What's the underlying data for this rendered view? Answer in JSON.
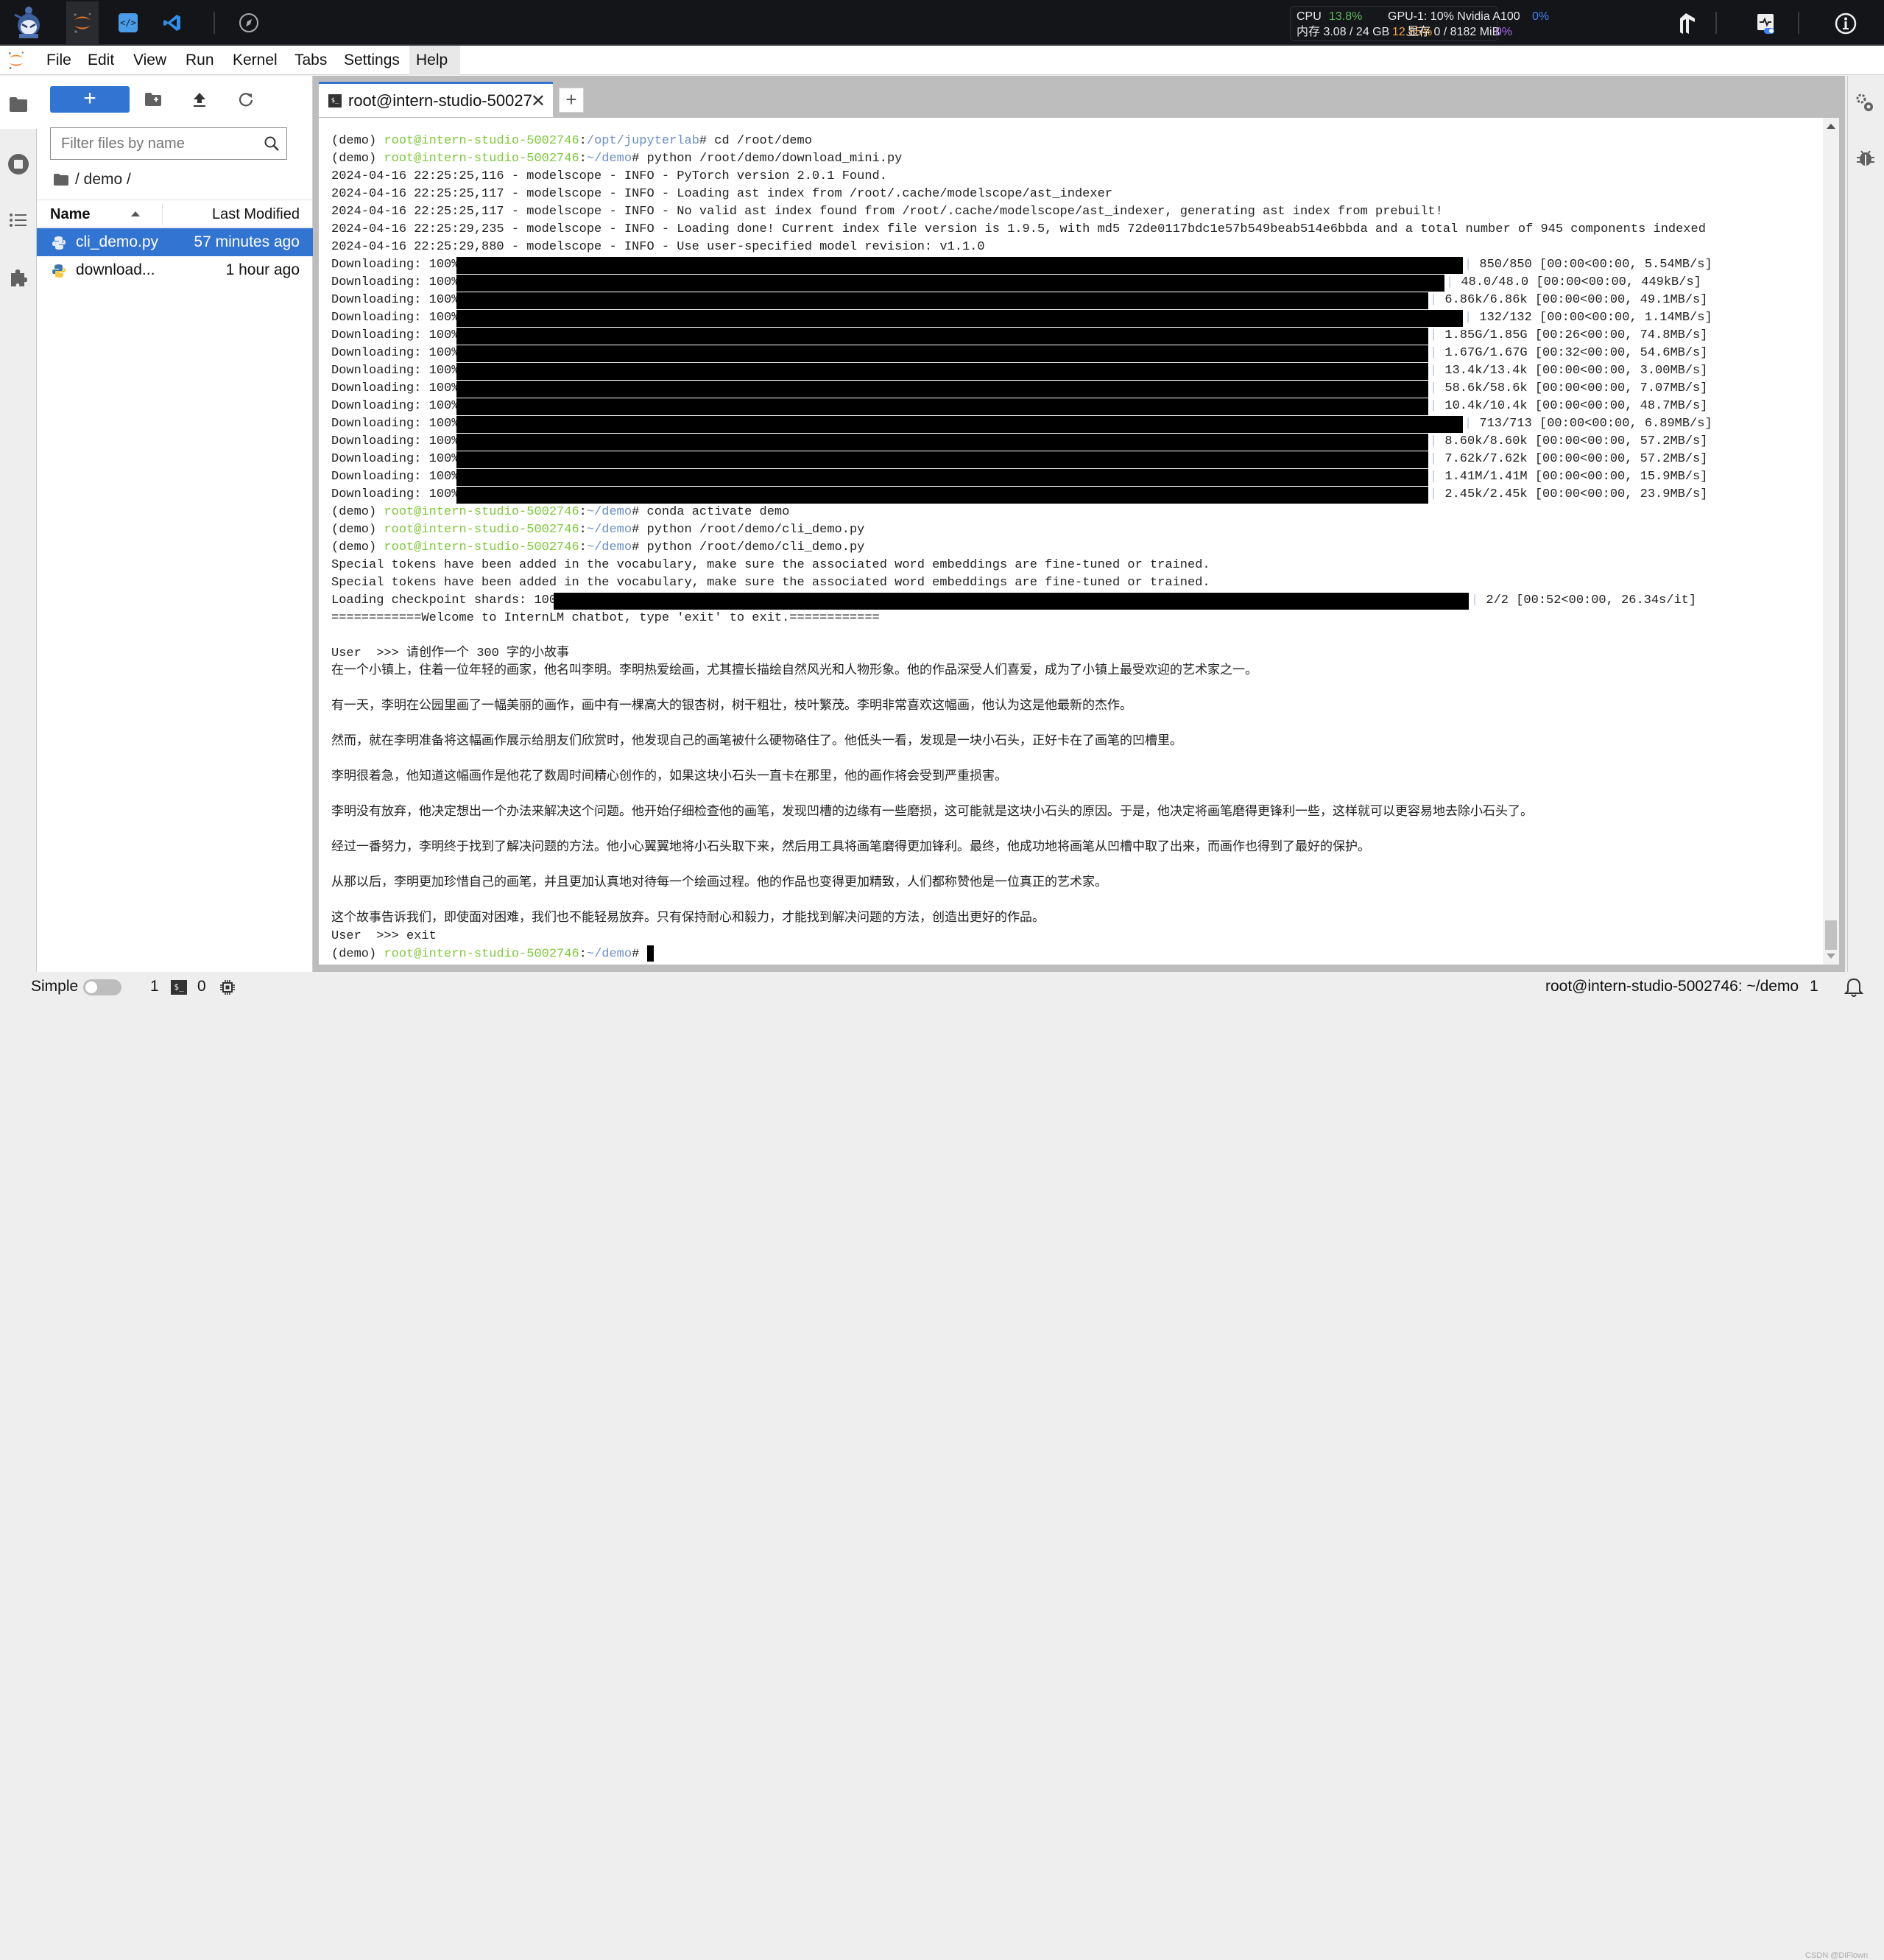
{
  "topbar": {
    "resources": {
      "cpu_label": "CPU",
      "cpu_value": "13.8%",
      "mem_label": "内存 3.08 / 24 GB",
      "mem_value": "12.85%",
      "gpu_label": "GPU-1: 10% Nvidia A100",
      "gpu_value": "0%",
      "vram_label": "显存 0 / 8182 MiB",
      "vram_value": "0%"
    },
    "colors": {
      "cpu": "#5cb85c",
      "mem": "#f0a64a",
      "gpu": "#3b82f6",
      "vram": "#a66bf0"
    }
  },
  "menubar": {
    "items": [
      "File",
      "Edit",
      "View",
      "Run",
      "Kernel",
      "Tabs",
      "Settings",
      "Help"
    ]
  },
  "filebrowser": {
    "new_button": "+",
    "filter_placeholder": "Filter files by name",
    "breadcrumb": "/ demo /",
    "columns": {
      "name": "Name",
      "modified": "Last Modified"
    },
    "files": [
      {
        "name": "cli_demo.py",
        "modified": "57 minutes ago",
        "selected": true
      },
      {
        "name": "download...",
        "modified": "1 hour ago",
        "selected": false
      }
    ]
  },
  "tabs": [
    {
      "label": "root@intern-studio-50027",
      "active": true
    }
  ],
  "terminal": {
    "env": "(demo) ",
    "userhost": "root@intern-studio-5002746",
    "commands": [
      {
        "path": "/opt/jupyterlab",
        "cmd": " cd /root/demo"
      },
      {
        "path": "~/demo",
        "cmd": " python /root/demo/download_mini.py"
      }
    ],
    "log_lines": [
      "2024-04-16 22:25:25,116 - modelscope - INFO - PyTorch version 2.0.1 Found.",
      "2024-04-16 22:25:25,117 - modelscope - INFO - Loading ast index from /root/.cache/modelscope/ast_indexer",
      "2024-04-16 22:25:25,117 - modelscope - INFO - No valid ast index found from /root/.cache/modelscope/ast_indexer, generating ast index from prebuilt!",
      "2024-04-16 22:25:29,235 - modelscope - INFO - Loading done! Current index file version is 1.9.5, with md5 72de0117bdc1e57b549beab514e6bbda and a total number of 945 components indexed",
      "2024-04-16 22:25:29,880 - modelscope - INFO - Use user-specified model revision: v1.1.0"
    ],
    "download_label": "Downloading: 100%",
    "downloads": [
      "850/850 [00:00<00:00, 5.54MB/s]",
      "48.0/48.0 [00:00<00:00, 449kB/s]",
      "6.86k/6.86k [00:00<00:00, 49.1MB/s]",
      "132/132 [00:00<00:00, 1.14MB/s]",
      "1.85G/1.85G [00:26<00:00, 74.8MB/s]",
      "1.67G/1.67G [00:32<00:00, 54.6MB/s]",
      "13.4k/13.4k [00:00<00:00, 3.00MB/s]",
      "58.6k/58.6k [00:00<00:00, 7.07MB/s]",
      "10.4k/10.4k [00:00<00:00, 48.7MB/s]",
      "713/713 [00:00<00:00, 6.89MB/s]",
      "8.60k/8.60k [00:00<00:00, 57.2MB/s]",
      "7.62k/7.62k [00:00<00:00, 57.2MB/s]",
      "1.41M/1.41M [00:00<00:00, 15.9MB/s]",
      "2.45k/2.45k [00:00<00:00, 23.9MB/s]"
    ],
    "commands2": [
      {
        "path": "~/demo",
        "cmd": " conda activate demo"
      },
      {
        "path": "~/demo",
        "cmd": " python /root/demo/cli_demo.py"
      },
      {
        "path": "~/demo",
        "cmd": " python /root/demo/cli_demo.py"
      }
    ],
    "warnings": [
      "Special tokens have been added in the vocabulary, make sure the associated word embeddings are fine-tuned or trained.",
      "Special tokens have been added in the vocabulary, make sure the associated word embeddings are fine-tuned or trained."
    ],
    "checkpoint_label": "Loading checkpoint shards: 100%",
    "checkpoint_stats": "2/2 [00:52<00:00, 26.34s/it]",
    "welcome": "============Welcome to InternLM chatbot, type 'exit' to exit.============",
    "user_prompt": "User  >>> 请创作一个 300 字的小故事",
    "story": [
      "在一个小镇上，住着一位年轻的画家，他名叫李明。李明热爱绘画，尤其擅长描绘自然风光和人物形象。他的作品深受人们喜爱，成为了小镇上最受欢迎的艺术家之一。",
      "有一天，李明在公园里画了一幅美丽的画作，画中有一棵高大的银杏树，树干粗壮，枝叶繁茂。李明非常喜欢这幅画，他认为这是他最新的杰作。",
      "然而，就在李明准备将这幅画作展示给朋友们欣赏时，他发现自己的画笔被什么硬物硌住了。他低头一看，发现是一块小石头，正好卡在了画笔的凹槽里。",
      "李明很着急，他知道这幅画作是他花了数周时间精心创作的，如果这块小石头一直卡在那里，他的画作将会受到严重损害。",
      "李明没有放弃，他决定想出一个办法来解决这个问题。他开始仔细检查他的画笔，发现凹槽的边缘有一些磨损，这可能就是这块小石头的原因。于是，他决定将画笔磨得更锋利一些，这样就可以更容易地去除小石头了。",
      "经过一番努力，李明终于找到了解决问题的方法。他小心翼翼地将小石头取下来，然后用工具将画笔磨得更加锋利。最终，他成功地将画笔从凹槽中取了出来，而画作也得到了最好的保护。",
      "从那以后，李明更加珍惜自己的画笔，并且更加认真地对待每一个绘画过程。他的作品也变得更加精致，人们都称赞他是一位真正的艺术家。",
      "这个故事告诉我们，即使面对困难，我们也不能轻易放弃。只有保持耐心和毅力，才能找到解决问题的方法，创造出更好的作品。"
    ],
    "exit_line": "User  >>> exit",
    "final_prompt": {
      "path": "~/demo",
      "cmd": " "
    }
  },
  "statusbar": {
    "mode_label": "Simple",
    "kernels_count": "1",
    "terminal_badge": "$_",
    "terminals_count": "0",
    "right_text": "root@intern-studio-5002746: ~/demo",
    "notif_count": "1",
    "watermark": "CSDN @DiFlown"
  }
}
